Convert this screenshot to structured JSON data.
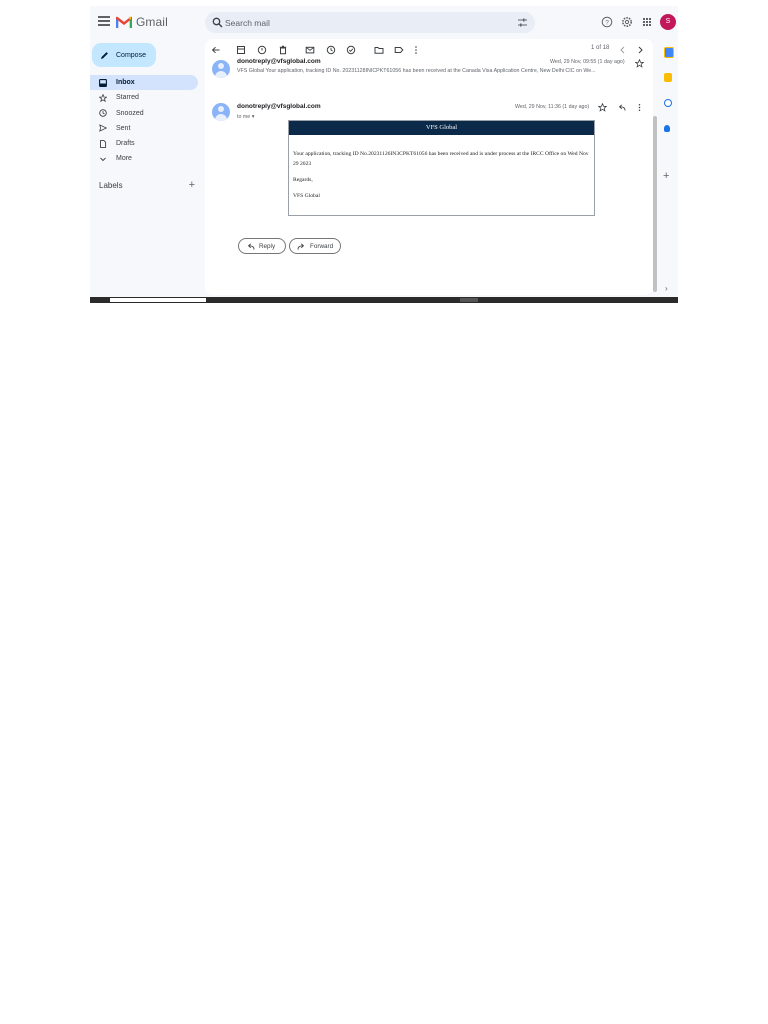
{
  "app": {
    "name": "Gmail"
  },
  "search": {
    "placeholder": "Search mail"
  },
  "header": {
    "avatar_initial": "S"
  },
  "sidebar": {
    "compose_label": "Compose",
    "items": [
      {
        "label": "Inbox",
        "icon": "inbox-icon",
        "active": true
      },
      {
        "label": "Starred",
        "icon": "star-icon"
      },
      {
        "label": "Snoozed",
        "icon": "clock-icon"
      },
      {
        "label": "Sent",
        "icon": "send-icon"
      },
      {
        "label": "Drafts",
        "icon": "draft-icon"
      },
      {
        "label": "More",
        "icon": "chevron-down-icon"
      }
    ],
    "labels_title": "Labels"
  },
  "toolbar": {
    "pager": "1 of 18"
  },
  "thread": {
    "messages": [
      {
        "sender": "donotreply@vfsglobal.com",
        "snippet": "VFS Global Your application, tracking ID No. 20231128INICPKT61056 has been received at the Canada Visa Application Centre, New Delhi CIC on We...",
        "date": "Wed, 29 Nov, 09:55 (1 day ago)"
      },
      {
        "sender": "donotreply@vfsglobal.com",
        "to": "to me",
        "date": "Wed, 29 Nov, 11:36 (1 day ago)"
      }
    ],
    "email_body": {
      "header": "VFS Global",
      "paragraph": "Your application, tracking ID No.20231126IN3CPKT61056 has been received and is under process at the IRCC Office on Wed Nov 29 2023",
      "regards": "Regards,",
      "signature": "VFS Global"
    },
    "reply_label": "Reply",
    "forward_label": "Forward"
  },
  "colors": {
    "accent": "#c2e7ff",
    "active_nav": "#d3e3fd",
    "email_header": "#0b2a4a",
    "avatar": "#c2185b"
  }
}
